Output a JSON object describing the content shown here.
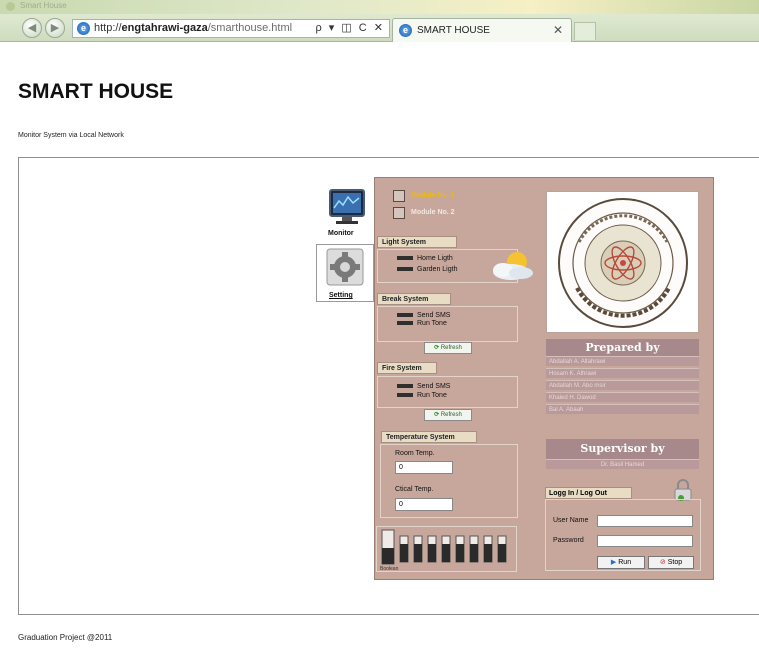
{
  "browser": {
    "window_title": "Smart House",
    "address": {
      "prefix": "http://",
      "host": "engtahrawi-gaza",
      "path": "/smarthouse.html",
      "tools": "ρ ▾ ◫ C ✕"
    },
    "tab_label": "SMART HOUSE",
    "tab_close": "✕",
    "back": "◀",
    "forward": "▶"
  },
  "page": {
    "title": "SMART HOUSE",
    "subtitle": "Monitor System via Local Network",
    "footer": "Graduation Project @2011"
  },
  "app": {
    "side_tabs": {
      "monitor": "Monitor",
      "setting": "Setting"
    },
    "modules": [
      {
        "label": "Module No. 1",
        "color": "#e8b81e"
      },
      {
        "label": "Module No. 2",
        "color": "#f1e8e2"
      }
    ],
    "light_system": {
      "title": "Light System",
      "items": [
        "Home Ligth",
        "Garden Ligth"
      ]
    },
    "break_system": {
      "title": "Break System",
      "items": [
        "Send SMS",
        "Run Tone"
      ],
      "refresh": "Refresh"
    },
    "fire_system": {
      "title": "Fire System",
      "items": [
        "Send SMS",
        "Run Tone"
      ],
      "refresh": "Refresh"
    },
    "temperature_system": {
      "title": "Temperature System",
      "room_label": "Room Temp.",
      "room_value": "0",
      "critical_label": "Ctical Temp.",
      "critical_value": "0"
    },
    "boolean_label": "Boolean",
    "prepared_by": {
      "title": "Prepared by",
      "names": [
        "Abdallah A. Altahrawi",
        "Hosam K. Alhrawi",
        "Abdallah M. Abo msir",
        "Khaled H. Dawod",
        "Bal A. Abaah"
      ]
    },
    "supervisor": {
      "title": "Supervisor by",
      "name": "Dr. Basil Hamed"
    },
    "login": {
      "title": "Logg In / Log Out",
      "user_label": "User Name",
      "password_label": "Password",
      "run_label": "Run",
      "stop_label": "Stop"
    }
  }
}
